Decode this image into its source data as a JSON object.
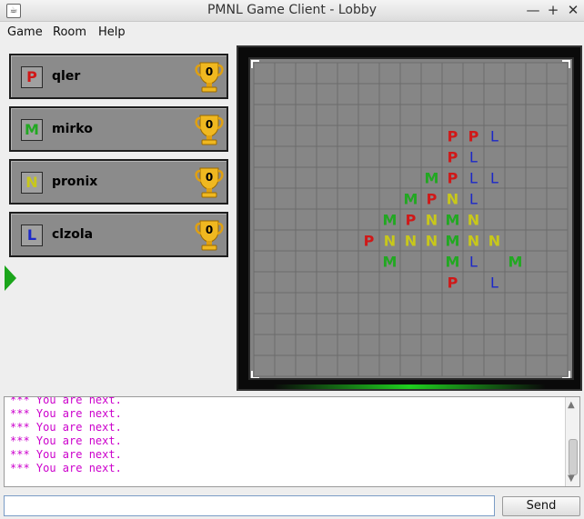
{
  "window": {
    "title": "PMNL Game Client - Lobby",
    "app_icon": "java-icon",
    "controls": {
      "minimize": "—",
      "maximize": "+",
      "close": "✕"
    }
  },
  "menu": [
    "Game",
    "Room",
    "Help"
  ],
  "players": [
    {
      "letter": "P",
      "name": "qler",
      "score": "0",
      "color": "#d01818"
    },
    {
      "letter": "M",
      "name": "mirko",
      "score": "0",
      "color": "#22a822"
    },
    {
      "letter": "N",
      "name": "pronix",
      "score": "0",
      "color": "#c8c81a"
    },
    {
      "letter": "L",
      "name": "clzola",
      "score": "0",
      "color": "#1c28c8"
    }
  ],
  "current_player": "clzola",
  "colors": {
    "P": "#d01818",
    "M": "#22a822",
    "N": "#c8c81a",
    "L": "#1c28c8"
  },
  "board": {
    "grid_size": 15,
    "pieces": [
      {
        "row": 3,
        "col": 9,
        "letter": "P"
      },
      {
        "row": 3,
        "col": 10,
        "letter": "P"
      },
      {
        "row": 3,
        "col": 11,
        "letter": "L"
      },
      {
        "row": 4,
        "col": 9,
        "letter": "P"
      },
      {
        "row": 4,
        "col": 10,
        "letter": "L"
      },
      {
        "row": 5,
        "col": 8,
        "letter": "M"
      },
      {
        "row": 5,
        "col": 9,
        "letter": "P"
      },
      {
        "row": 5,
        "col": 10,
        "letter": "L"
      },
      {
        "row": 5,
        "col": 11,
        "letter": "L"
      },
      {
        "row": 6,
        "col": 7,
        "letter": "M"
      },
      {
        "row": 6,
        "col": 8,
        "letter": "P"
      },
      {
        "row": 6,
        "col": 9,
        "letter": "N"
      },
      {
        "row": 6,
        "col": 10,
        "letter": "L"
      },
      {
        "row": 7,
        "col": 6,
        "letter": "M"
      },
      {
        "row": 7,
        "col": 7,
        "letter": "P"
      },
      {
        "row": 7,
        "col": 8,
        "letter": "N"
      },
      {
        "row": 7,
        "col": 9,
        "letter": "M"
      },
      {
        "row": 7,
        "col": 10,
        "letter": "N"
      },
      {
        "row": 8,
        "col": 5,
        "letter": "P"
      },
      {
        "row": 8,
        "col": 6,
        "letter": "N"
      },
      {
        "row": 8,
        "col": 7,
        "letter": "N"
      },
      {
        "row": 8,
        "col": 8,
        "letter": "N"
      },
      {
        "row": 8,
        "col": 9,
        "letter": "M"
      },
      {
        "row": 8,
        "col": 10,
        "letter": "N"
      },
      {
        "row": 8,
        "col": 11,
        "letter": "N"
      },
      {
        "row": 9,
        "col": 6,
        "letter": "M"
      },
      {
        "row": 9,
        "col": 9,
        "letter": "M"
      },
      {
        "row": 9,
        "col": 10,
        "letter": "L"
      },
      {
        "row": 9,
        "col": 12,
        "letter": "M"
      },
      {
        "row": 10,
        "col": 9,
        "letter": "P"
      },
      {
        "row": 10,
        "col": 11,
        "letter": "L"
      }
    ]
  },
  "chat": {
    "lines": [
      "*** You are next.",
      "*** You are next.",
      "*** You are next.",
      "*** You are next.",
      "*** You are next.",
      "*** You are next."
    ],
    "input_value": "",
    "send_label": "Send"
  }
}
